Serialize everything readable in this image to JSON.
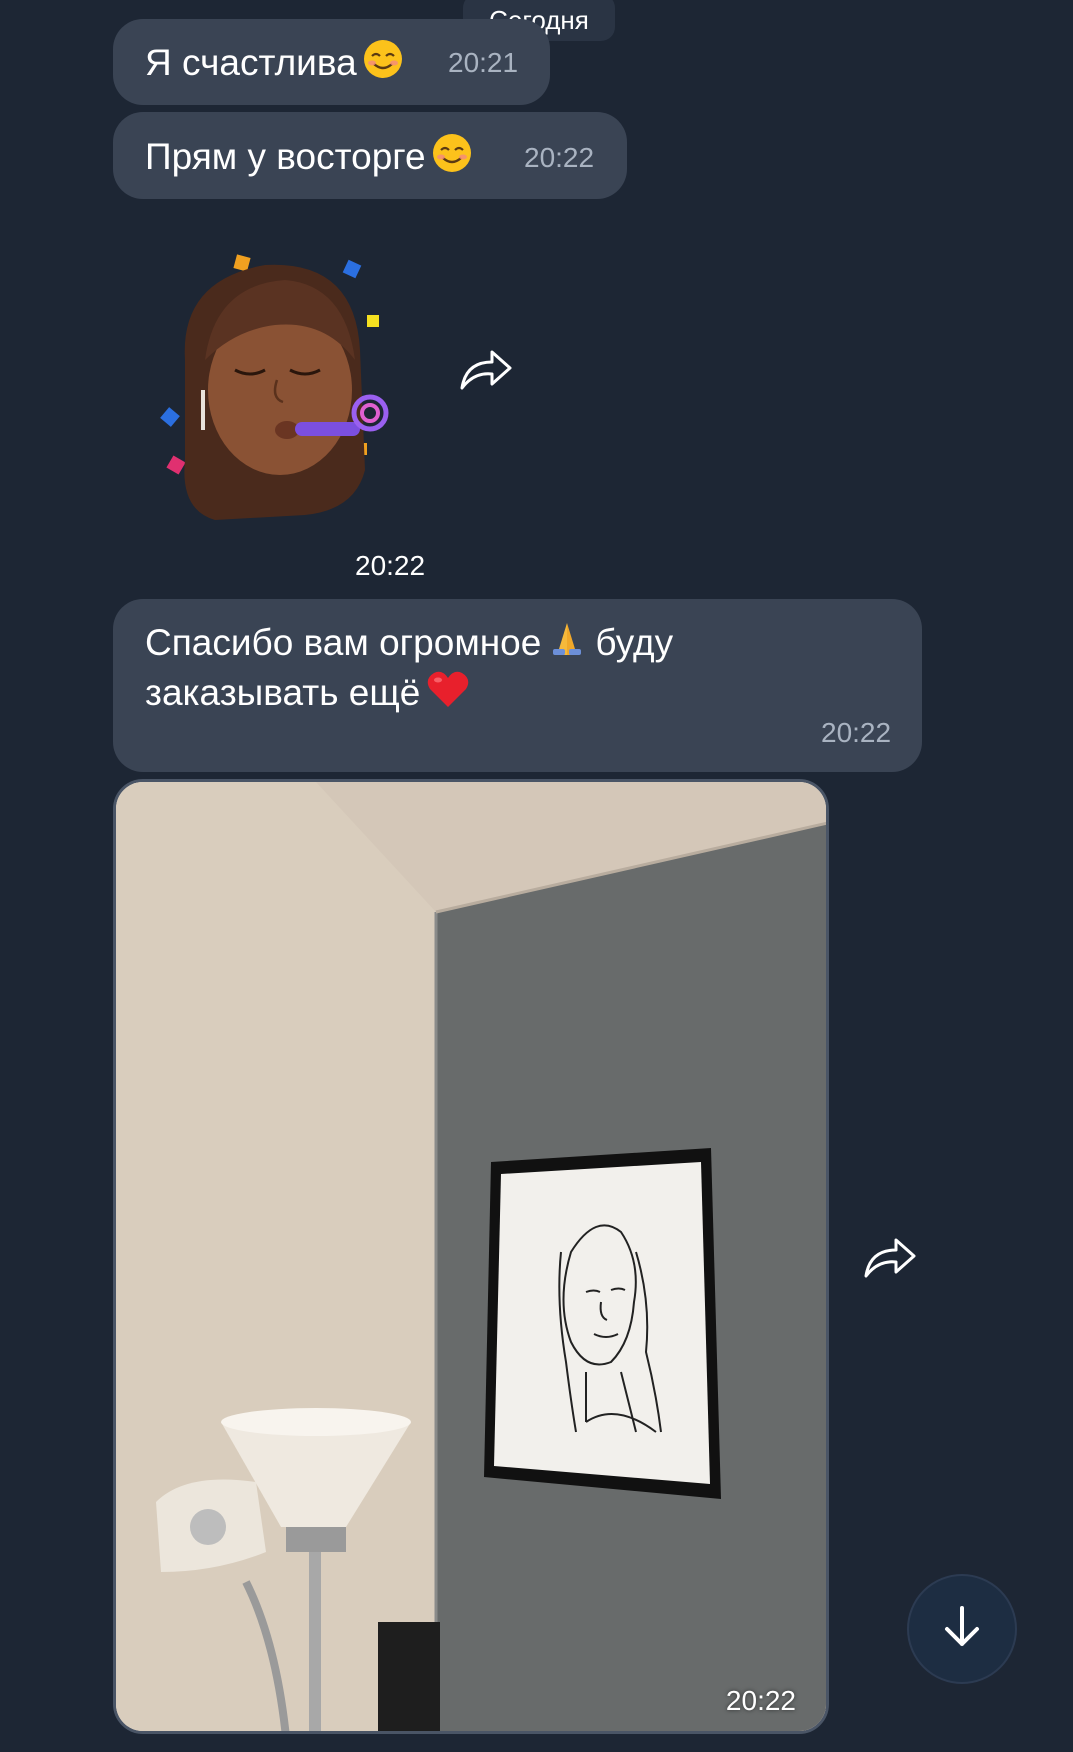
{
  "date_separator": "Сегодня",
  "messages": [
    {
      "text": "Я счастлива",
      "emoji": "smiling-face-icon",
      "time": "20:21"
    },
    {
      "text": "Прям у восторге",
      "emoji": "smiling-face-icon",
      "time": "20:22"
    },
    {
      "sticker": "memoji-party-horn-sticker",
      "time": "20:22"
    },
    {
      "line1": "Спасибо вам огромное",
      "line1_suffix": "буду",
      "line2": "заказывать ещё",
      "emojis": [
        "folded-hands-icon",
        "red-heart-icon"
      ],
      "time": "20:22"
    },
    {
      "photo": "framed-portrait-on-wall-photo",
      "time": "20:22"
    }
  ],
  "colors": {
    "background": "#1d2634",
    "bubble": "#3a4454",
    "timestamp": "#a9b3c1"
  },
  "icons": {
    "share": "share-arrow-icon",
    "scroll": "arrow-down-icon"
  }
}
